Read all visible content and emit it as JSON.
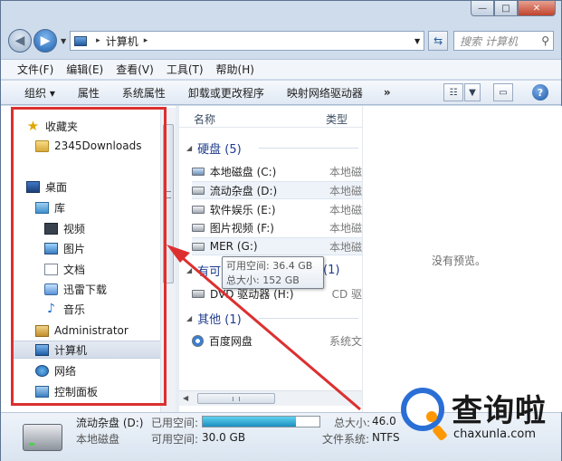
{
  "window": {
    "min_label": "—",
    "max_label": "□",
    "close_label": "✕"
  },
  "address": {
    "path": [
      "计算机"
    ],
    "separator": "▸"
  },
  "search": {
    "placeholder": "搜索 计算机"
  },
  "menu": [
    "文件(F)",
    "编辑(E)",
    "查看(V)",
    "工具(T)",
    "帮助(H)"
  ],
  "toolbar": {
    "items": [
      "组织 ▾",
      "属性",
      "系统属性",
      "卸载或更改程序",
      "映射网络驱动器"
    ],
    "more": "»",
    "help": "?"
  },
  "nav": {
    "favorites": "收藏夹",
    "downloads": "2345Downloads",
    "desktop": "桌面",
    "library": "库",
    "video": "视频",
    "pictures": "图片",
    "documents": "文档",
    "thunder": "迅雷下载",
    "music": "音乐",
    "admin": "Administrator",
    "computer": "计算机",
    "network": "网络",
    "control_panel": "控制面板"
  },
  "columns": {
    "name": "名称",
    "type": "类型"
  },
  "groups": {
    "hdd": {
      "label": "硬盘 (5)"
    },
    "removable": {
      "label": "有可",
      "count": "(1)"
    },
    "other": {
      "label": "其他 (1)"
    }
  },
  "drives": [
    {
      "name": "本地磁盘 (C:)",
      "type": "本地磁"
    },
    {
      "name": "流动杂盘 (D:)",
      "type": "本地磁"
    },
    {
      "name": "软件娱乐 (E:)",
      "type": "本地磁"
    },
    {
      "name": "图片视频 (F:)",
      "type": "本地磁"
    },
    {
      "name": "MER (G:)",
      "type": "本地磁"
    },
    {
      "name": "DVD 驱动器 (H:)",
      "type": "CD 驱"
    },
    {
      "name": "百度网盘",
      "type": "系统文"
    }
  ],
  "tooltip": {
    "free": "可用空间: 36.4 GB",
    "total": "总大小: 152 GB"
  },
  "preview": {
    "empty_text": "没有预览。"
  },
  "details": {
    "name": "流动杂盘 (D:)",
    "type": "本地磁盘",
    "used_label": "已用空间:",
    "used_fraction": 0.8,
    "free_label": "可用空间:",
    "free_value": "30.0 GB",
    "total_label": "总大小:",
    "total_value": "46.0",
    "fs_label": "文件系统:",
    "fs_value": "NTFS"
  },
  "watermark": {
    "cn": "查询啦",
    "en": "chaxunla.com"
  },
  "colors": {
    "annotation_red": "#dc3030",
    "group_header_blue": "#1e3c8c"
  }
}
